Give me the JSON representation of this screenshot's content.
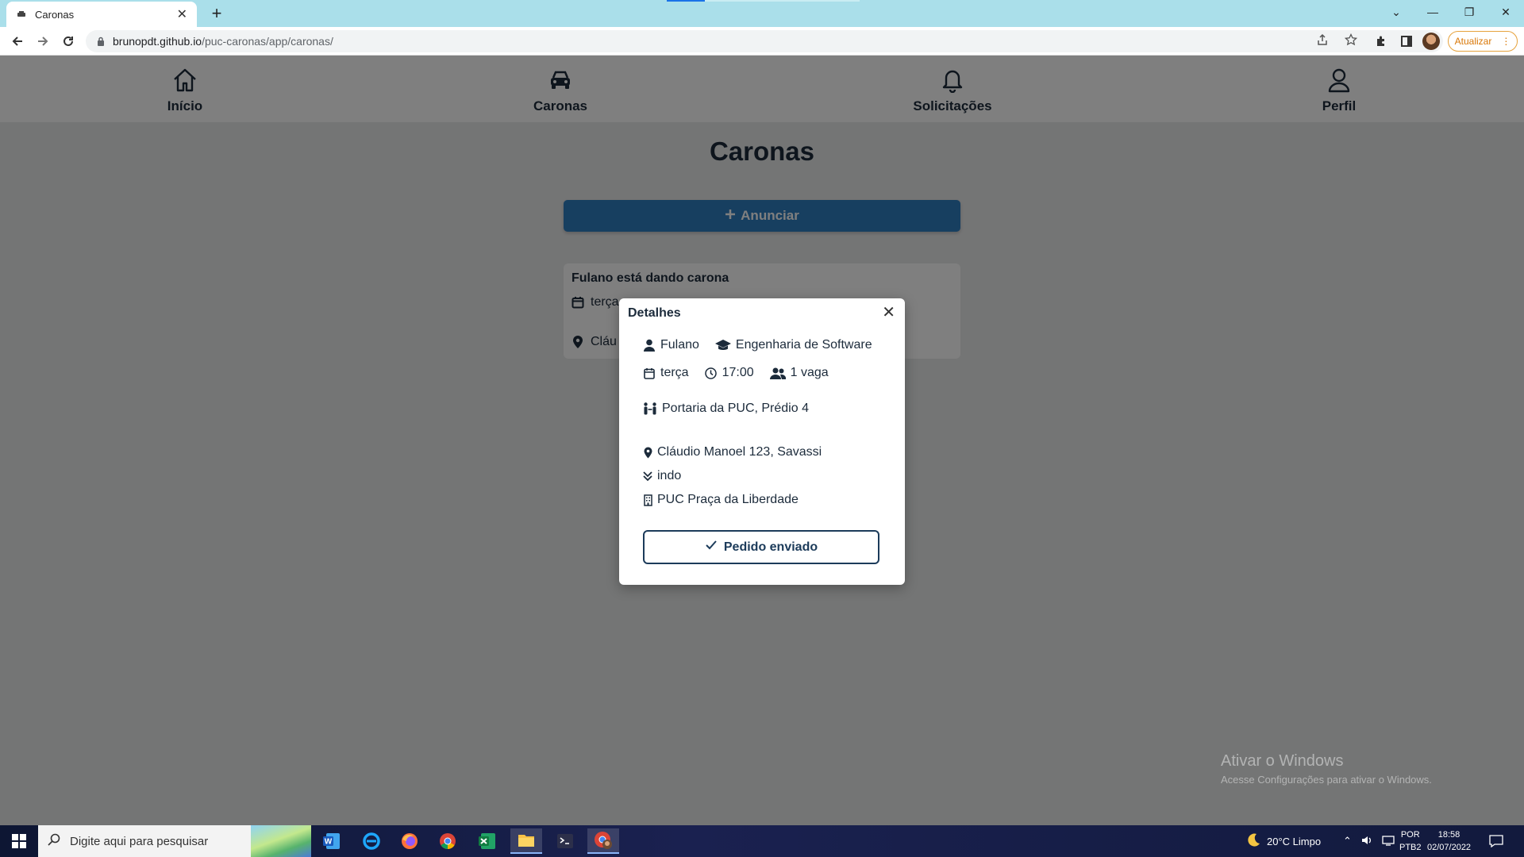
{
  "browser": {
    "tab_title": "Caronas",
    "url_host": "brunopdt.github.io",
    "url_path": "/puc-caronas/app/caronas/",
    "update_label": "Atualizar"
  },
  "nav": {
    "items": [
      {
        "label": "Início",
        "icon": "home-icon"
      },
      {
        "label": "Caronas",
        "icon": "car-icon"
      },
      {
        "label": "Solicitações",
        "icon": "bell-icon"
      },
      {
        "label": "Perfil",
        "icon": "user-icon"
      }
    ]
  },
  "main": {
    "title": "Caronas",
    "announce_label": "Anunciar",
    "card": {
      "title": "Fulano está dando carona",
      "day_partial": "terça",
      "place_partial": "Cláu"
    }
  },
  "modal": {
    "title": "Detalhes",
    "driver": "Fulano",
    "course": "Engenharia de Software",
    "day": "terça",
    "time": "17:00",
    "seats": "1 vaga",
    "meeting_point": "Portaria da PUC, Prédio 4",
    "address": "Cláudio Manoel 123, Savassi",
    "direction": "indo",
    "destination": "PUC Praça da Liberdade",
    "request_label": "Pedido enviado"
  },
  "watermark": {
    "line1": "Ativar o Windows",
    "line2": "Acesse Configurações para ativar o Windows."
  },
  "taskbar": {
    "search_placeholder": "Digite aqui para pesquisar",
    "weather": "20°C  Limpo",
    "lang1": "POR",
    "lang2": "PTB2",
    "time": "18:58",
    "date": "02/07/2022"
  },
  "colors": {
    "primary_dark": "#1c2b3b",
    "accent_blue": "#2f7fc1",
    "tab_strip": "#aadfea"
  }
}
